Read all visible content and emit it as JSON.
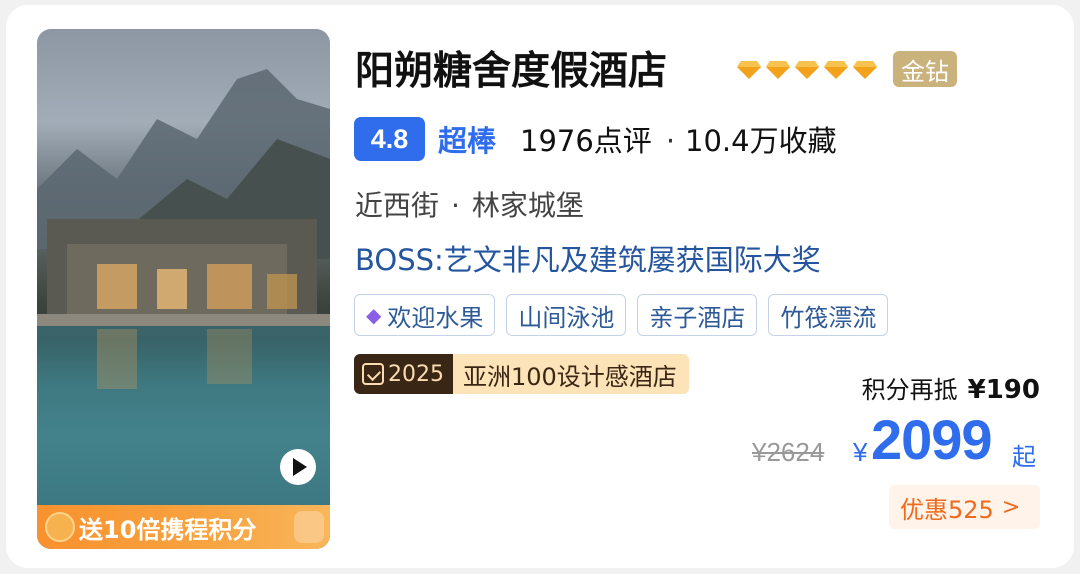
{
  "hotel": {
    "name": "阳朔糖舍度假酒店",
    "diamond_count": 5,
    "grade_badge": "金钻",
    "score": "4.8",
    "score_word": "超棒",
    "reviews": "1976点评",
    "favorites": "10.4万收藏",
    "location_street": "近西街",
    "location_area": "林家城堡",
    "boss_note": "BOSS:艺文非凡及建筑屡获国际大奖"
  },
  "tags": [
    "欢迎水果",
    "山间泳池",
    "亲子酒店",
    "竹筏漂流"
  ],
  "award": {
    "year": "2025",
    "title": "亚洲100设计感酒店"
  },
  "promo_banner": "送10倍携程积分",
  "pricing": {
    "points_label": "积分再抵",
    "points_value": "¥190",
    "original_price": "¥2624",
    "currency": "¥",
    "price": "2099",
    "price_suffix": "起",
    "discount": "优惠525"
  },
  "colors": {
    "accent_blue": "#2f6ded",
    "diamond_gold": "#f2a21b",
    "grade_badge": "#c9b27c",
    "discount_orange": "#f06a1c",
    "promo_orange": "#f8912e"
  },
  "icons": {
    "diamond": "diamond-icon",
    "gem": "gem-icon",
    "play": "play-icon",
    "medal": "medal-icon",
    "chevron": "chevron-right-icon"
  }
}
